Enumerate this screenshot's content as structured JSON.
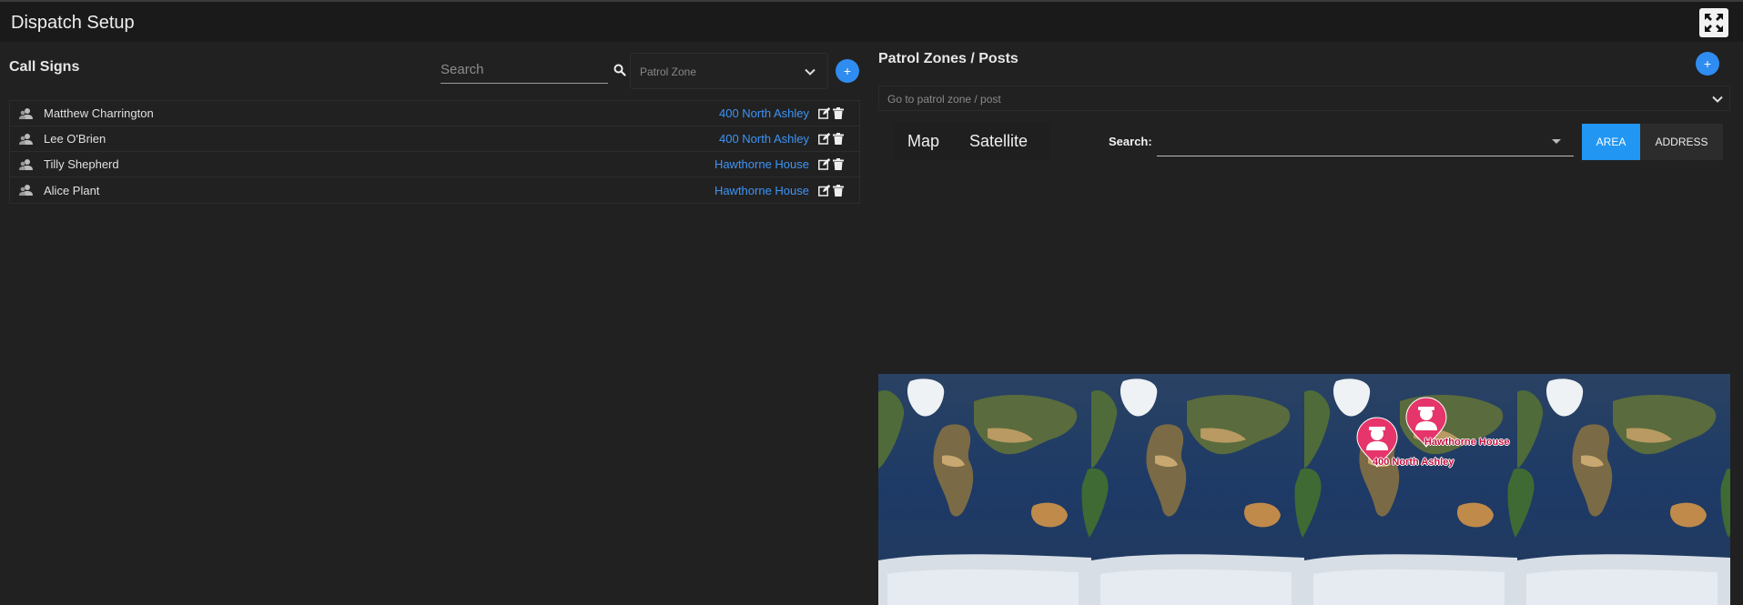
{
  "header": {
    "title": "Dispatch Setup",
    "fullscreen_icon": "fullscreen-icon"
  },
  "call_signs": {
    "title": "Call Signs",
    "search_placeholder": "Search",
    "patrol_zone_placeholder": "Patrol Zone",
    "add_label": "+",
    "rows": [
      {
        "name": "Matthew Charrington",
        "zone": "400 North Ashley"
      },
      {
        "name": "Lee O'Brien",
        "zone": "400 North Ashley"
      },
      {
        "name": "Tilly Shepherd",
        "zone": "Hawthorne House"
      },
      {
        "name": "Alice Plant",
        "zone": "Hawthorne House"
      }
    ]
  },
  "patrol_zones": {
    "title": "Patrol Zones / Posts",
    "add_label": "+",
    "goto_placeholder": "Go to patrol zone / post",
    "map_tab": "Map",
    "satellite_tab": "Satellite",
    "search_label": "Search:",
    "area_button": "AREA",
    "address_button": "ADDRESS",
    "markers": [
      {
        "label": "400 North Ashley"
      },
      {
        "label": "Hawthorne House"
      }
    ]
  },
  "colors": {
    "accent": "#2196f3",
    "link": "#3d94f6",
    "marker": "#e5356a"
  }
}
